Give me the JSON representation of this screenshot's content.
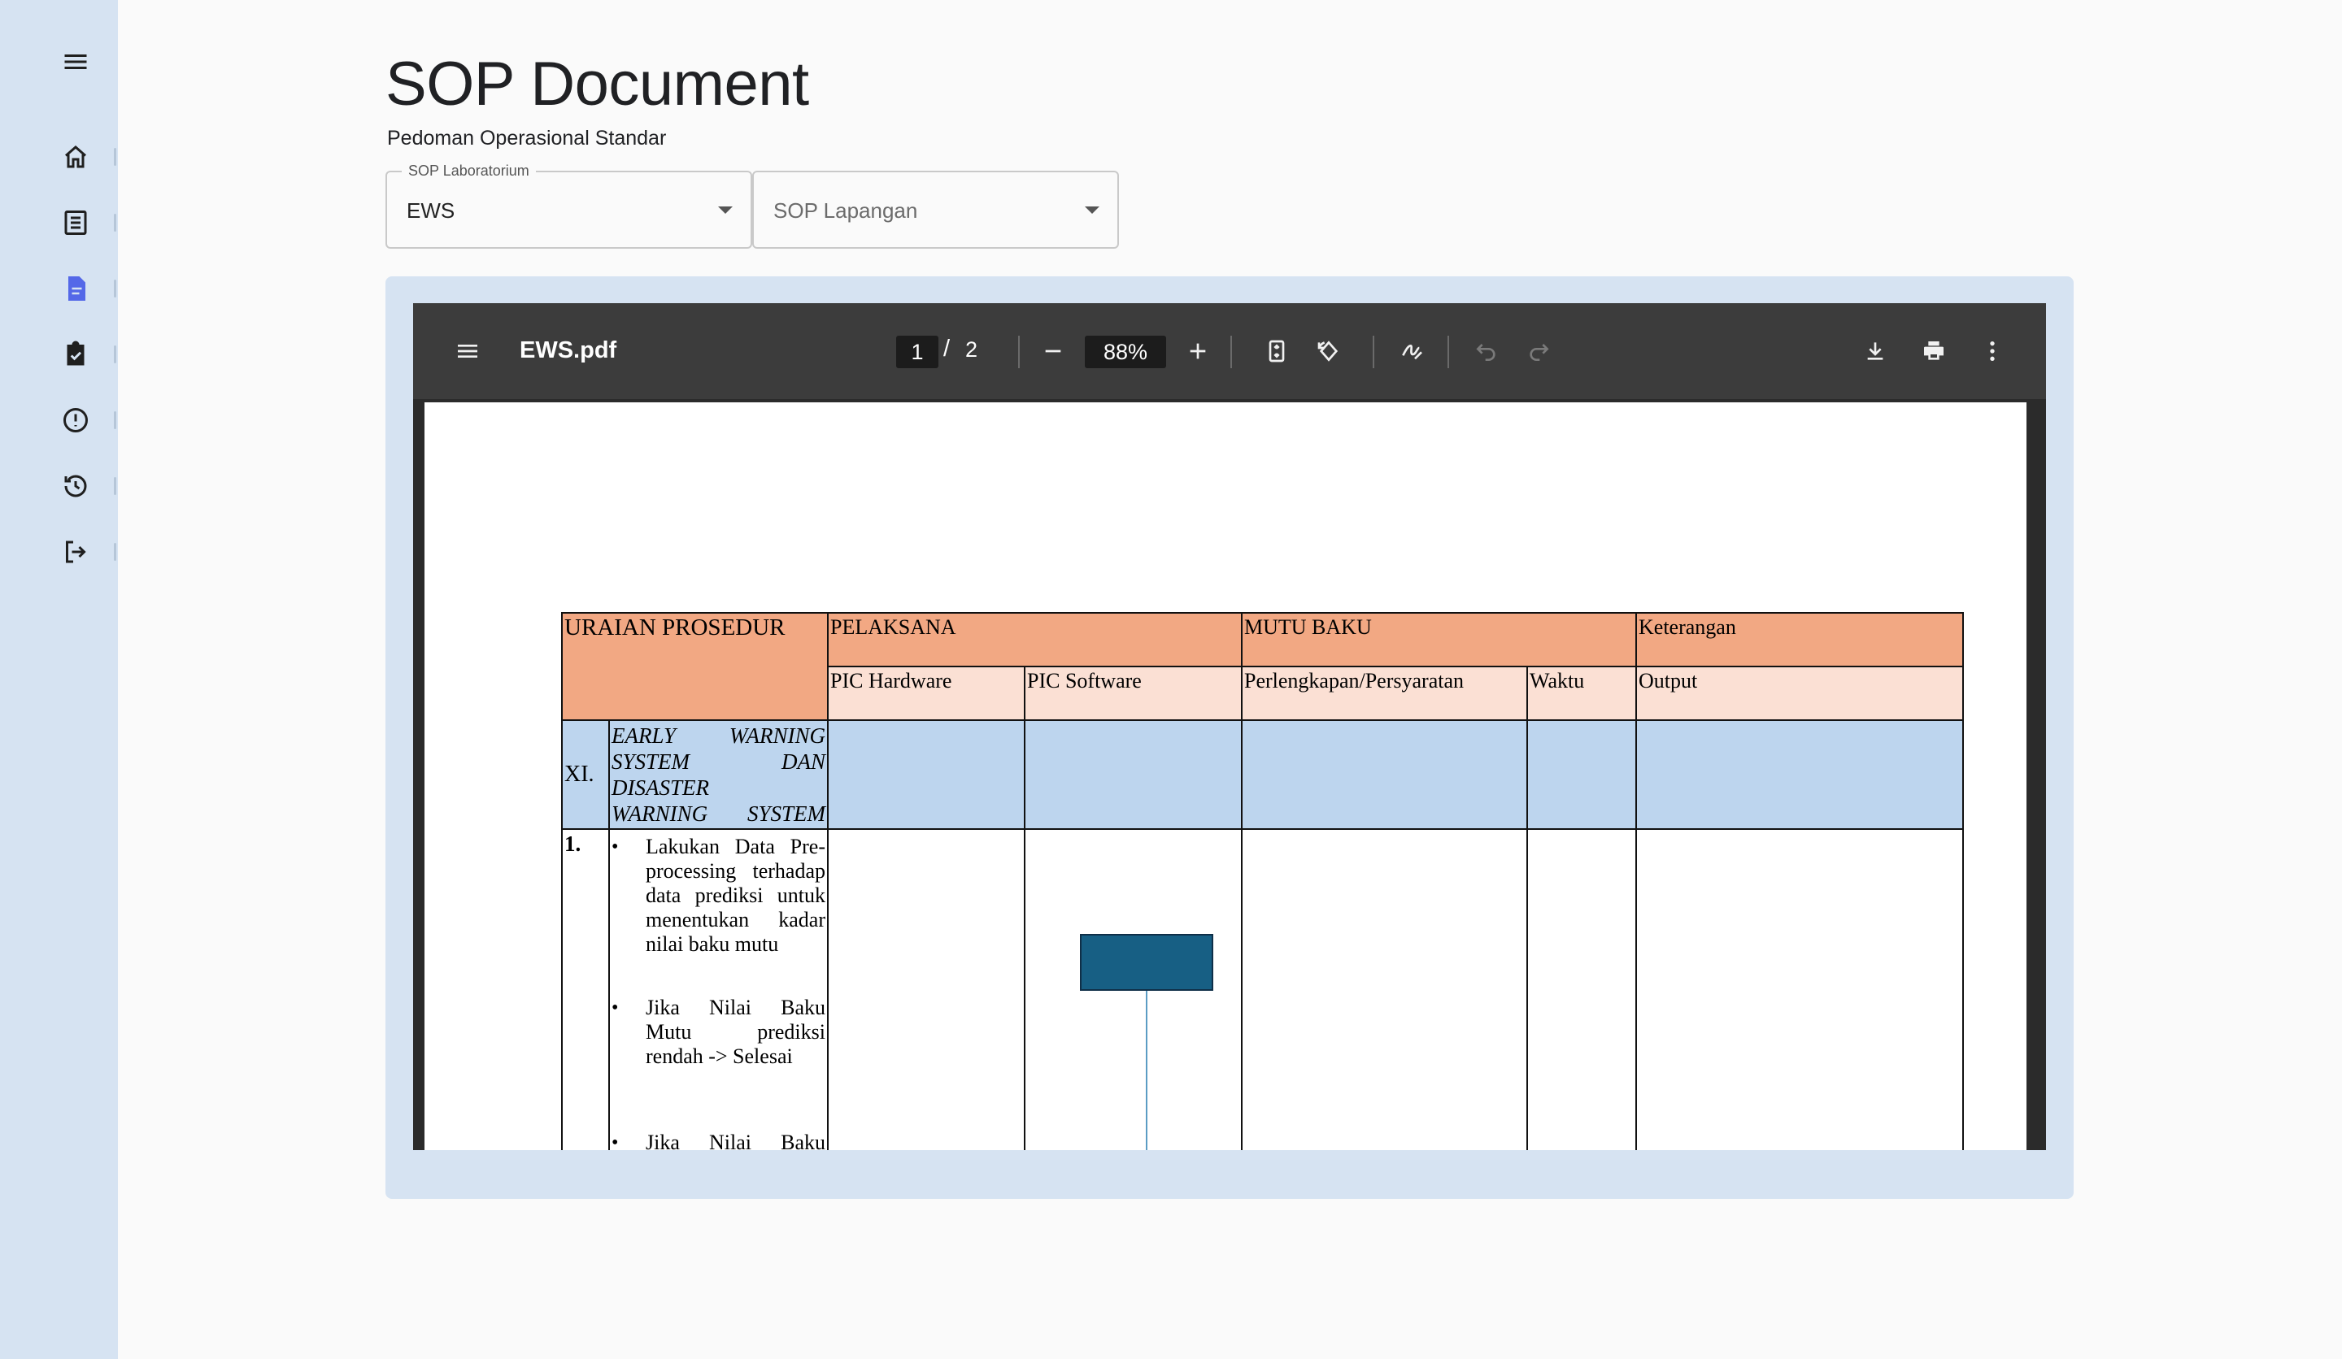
{
  "page": {
    "title": "SOP Document",
    "subtitle": "Pedoman Operasional Standar"
  },
  "sidebar": {
    "items": [
      {
        "icon": "menu-icon"
      },
      {
        "icon": "home-icon"
      },
      {
        "icon": "list-icon"
      },
      {
        "icon": "document-icon",
        "active": true
      },
      {
        "icon": "clipboard-check-icon"
      },
      {
        "icon": "alert-icon"
      },
      {
        "icon": "history-icon"
      },
      {
        "icon": "logout-icon"
      }
    ]
  },
  "selects": {
    "lab": {
      "label": "SOP Laboratorium",
      "value": "EWS"
    },
    "field": {
      "placeholder": "SOP Lapangan"
    }
  },
  "viewer": {
    "file_name": "EWS.pdf",
    "current_page": "1",
    "separator": "/",
    "total_pages": "2",
    "zoom": "88%"
  },
  "document": {
    "headers": {
      "uraian": "URAIAN PROSEDUR",
      "pelaksana": "PELAKSANA",
      "mutu_baku": "MUTU BAKU",
      "keterangan": "Keterangan",
      "pic_hardware": "PIC Hardware",
      "pic_software": "PIC Software",
      "perlengkapan": "Perlengkapan/Persyaratan",
      "waktu": "Waktu",
      "output": "Output"
    },
    "section": {
      "number": "XI.",
      "title_lines": [
        "EARLY WARNING",
        "SYSTEM DAN",
        "DISASTER",
        "WARNING SYSTEM"
      ]
    },
    "step": {
      "number": "1.",
      "bullets": [
        "Lakukan Data Pre-processing terhadap data prediksi untuk menentukan kadar nilai baku mutu",
        "Jika Nilai Baku Mutu prediksi rendah -> Selesai",
        "Jika Nilai Baku Mutu Sedang - Tinggi -> kirim data"
      ]
    }
  },
  "colors": {
    "sidebar_bg": "#d6e3f2",
    "active_icon": "#5468e8",
    "header_orange": "#f2a883",
    "header_light": "#fbe0d4",
    "section_blue": "#bdd5ee",
    "flow_box": "#175f84"
  }
}
